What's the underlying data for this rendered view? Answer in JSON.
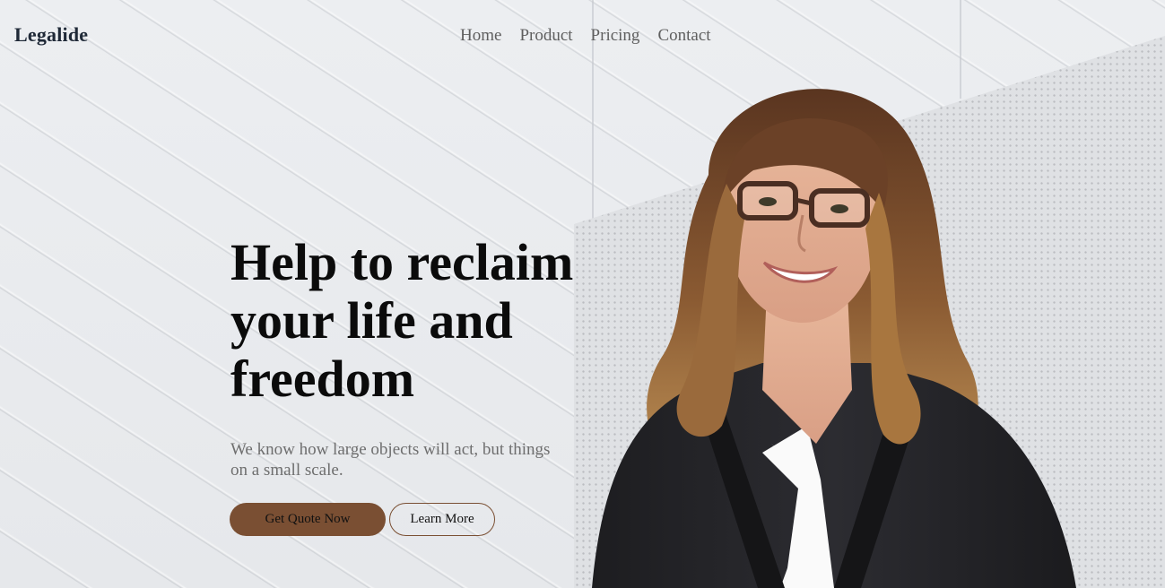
{
  "brand": {
    "name": "Legalide"
  },
  "nav": {
    "items": [
      {
        "label": "Home"
      },
      {
        "label": "Product"
      },
      {
        "label": "Pricing"
      },
      {
        "label": "Contact"
      }
    ]
  },
  "hero": {
    "headline": "Help to reclaim your life and freedom",
    "subtext": "We know how large objects will act, but things on a small scale.",
    "primary_cta": "Get Quote Now",
    "secondary_cta": "Learn More"
  },
  "colors": {
    "accent": "#7a4f33",
    "heading": "#0b0b0b",
    "nav_text": "#5f5f5f",
    "logo": "#1f2937"
  }
}
